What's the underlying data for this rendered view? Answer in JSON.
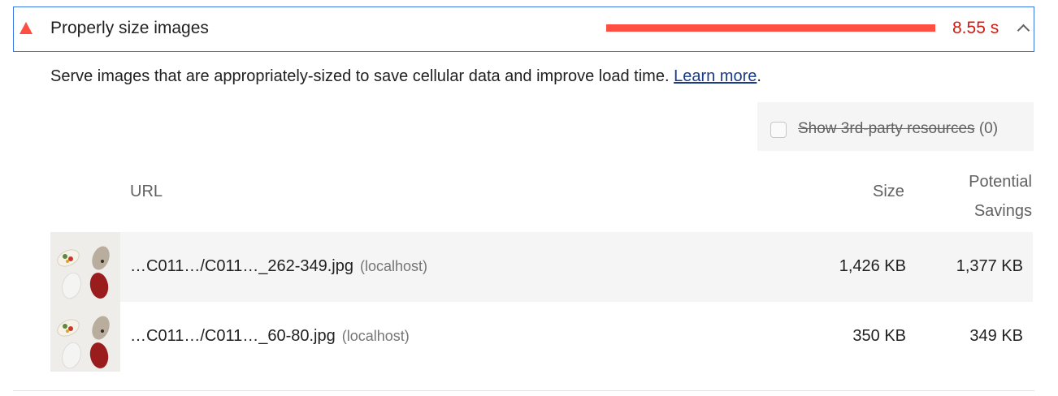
{
  "audit": {
    "title": "Properly size images",
    "savings_time": "8.55 s",
    "status_color": "#ff4e42",
    "icons": {
      "status": "warning-triangle-icon",
      "toggle": "chevron-up-icon"
    }
  },
  "description": {
    "text": "Serve images that are appropriately-sized to save cellular data and improve load time.",
    "link_text": "Learn more",
    "trailing": "."
  },
  "third_party": {
    "label": "Show 3rd-party resources",
    "count": "(0)",
    "checked": false
  },
  "table": {
    "headers": {
      "url": "URL",
      "size": "Size",
      "savings_line1": "Potential",
      "savings_line2": "Savings"
    },
    "rows": [
      {
        "url": "…C011…/C011…_262-349.jpg",
        "host": "(localhost)",
        "size": "1,426 KB",
        "savings": "1,377 KB"
      },
      {
        "url": "…C011…/C011…_60-80.jpg",
        "host": "(localhost)",
        "size": "350 KB",
        "savings": "349 KB"
      }
    ]
  }
}
